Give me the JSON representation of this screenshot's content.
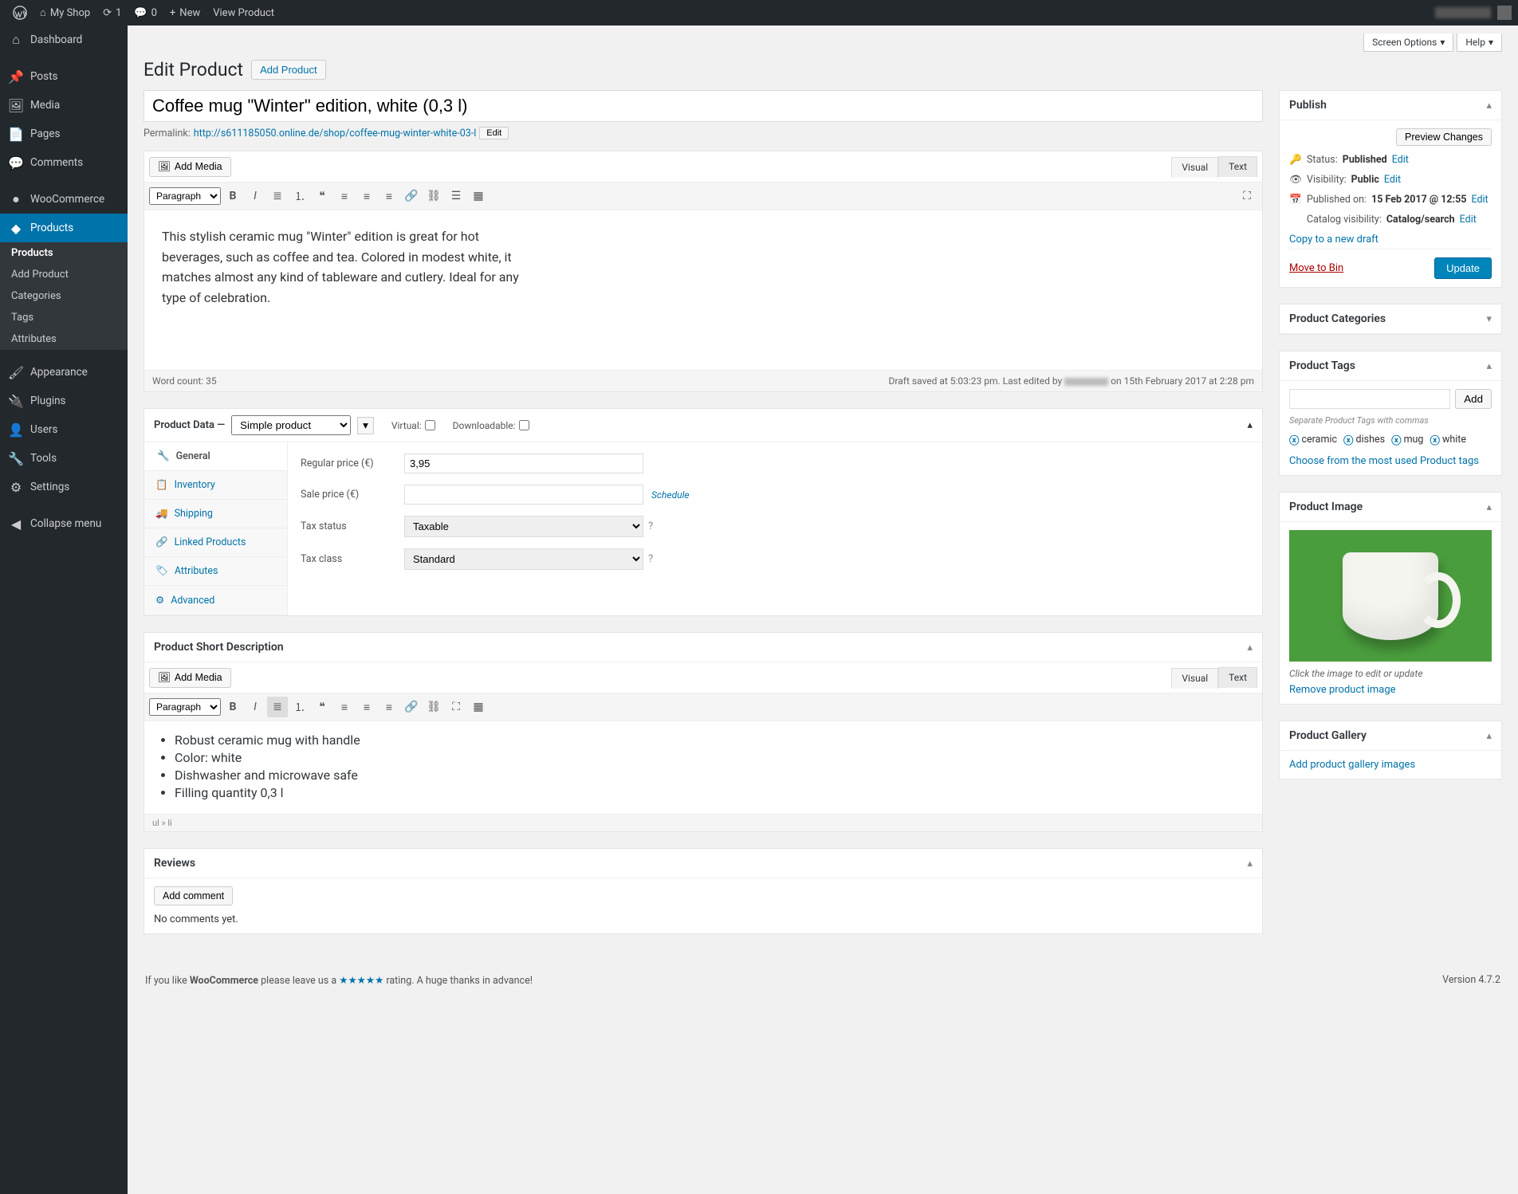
{
  "adminBar": {
    "siteName": "My Shop",
    "updates": "1",
    "comments": "0",
    "new": "New",
    "viewProduct": "View Product"
  },
  "sidebar": {
    "dashboard": "Dashboard",
    "posts": "Posts",
    "media": "Media",
    "pages": "Pages",
    "comments": "Comments",
    "woocommerce": "WooCommerce",
    "products": "Products",
    "appearance": "Appearance",
    "plugins": "Plugins",
    "users": "Users",
    "tools": "Tools",
    "settings": "Settings",
    "collapse": "Collapse menu",
    "sub": {
      "products": "Products",
      "addProduct": "Add Product",
      "categories": "Categories",
      "tags": "Tags",
      "attributes": "Attributes"
    }
  },
  "topTabs": {
    "screenOptions": "Screen Options",
    "help": "Help"
  },
  "header": {
    "title": "Edit Product",
    "addBtn": "Add Product"
  },
  "title": "Coffee mug \"Winter\" edition, white (0,3 l)",
  "permalink": {
    "label": "Permalink:",
    "base": "http://s611185050.online.de/shop/",
    "slug": "coffee-mug-winter-white-03-l",
    "edit": "Edit"
  },
  "editor": {
    "addMedia": "Add Media",
    "visual": "Visual",
    "text": "Text",
    "paragraph": "Paragraph",
    "content": "This stylish ceramic mug \"Winter\" edition is great for hot beverages, such as coffee and tea. Colored in modest white, it matches almost any kind of tableware and cutlery. Ideal for any type of celebration.",
    "wordCount": "Word count: 35",
    "status_prefix": "Draft saved at 5:03:23 pm. Last edited by ",
    "status_suffix": " on 15th February 2017 at 2:28 pm"
  },
  "productData": {
    "title": "Product Data —",
    "type": "Simple product",
    "virtual": "Virtual:",
    "downloadable": "Downloadable:",
    "tabs": {
      "general": "General",
      "inventory": "Inventory",
      "shipping": "Shipping",
      "linked": "Linked Products",
      "attributes": "Attributes",
      "advanced": "Advanced"
    },
    "regularPriceLabel": "Regular price (€)",
    "regularPrice": "3,95",
    "salePriceLabel": "Sale price (€)",
    "salePrice": "",
    "schedule": "Schedule",
    "taxStatusLabel": "Tax status",
    "taxStatus": "Taxable",
    "taxClassLabel": "Tax class",
    "taxClass": "Standard"
  },
  "shortDesc": {
    "title": "Product Short Description",
    "items": [
      "Robust ceramic mug with  handle",
      "Color: white",
      "Dishwasher and microwave safe",
      "Filling quantity 0,3 l"
    ],
    "path": "ul » li"
  },
  "reviews": {
    "title": "Reviews",
    "addComment": "Add comment",
    "empty": "No comments yet."
  },
  "publish": {
    "title": "Publish",
    "preview": "Preview Changes",
    "statusLabel": "Status:",
    "status": "Published",
    "edit": "Edit",
    "visibilityLabel": "Visibility:",
    "visibility": "Public",
    "publishedOnLabel": "Published on:",
    "publishedOn": "15 Feb 2017 @ 12:55",
    "catalogVisibilityLabel": "Catalog visibility:",
    "catalogVisibility": "Catalog/search",
    "copyDraft": "Copy to a new draft",
    "moveBin": "Move to Bin",
    "update": "Update"
  },
  "categories": {
    "title": "Product Categories"
  },
  "tags": {
    "title": "Product Tags",
    "add": "Add",
    "hint": "Separate Product Tags with commas",
    "items": [
      "ceramic",
      "dishes",
      "mug",
      "white"
    ],
    "choose": "Choose from the most used Product tags"
  },
  "productImage": {
    "title": "Product Image",
    "caption": "Click the image to edit or update",
    "remove": "Remove product image"
  },
  "gallery": {
    "title": "Product Gallery",
    "add": "Add product gallery images"
  },
  "footer": {
    "like_prefix": "If you like ",
    "wc": "WooCommerce",
    "like_mid": " please leave us a ",
    "stars": "★★★★★",
    "like_suffix": " rating. A huge thanks in advance!",
    "version": "Version 4.7.2"
  }
}
